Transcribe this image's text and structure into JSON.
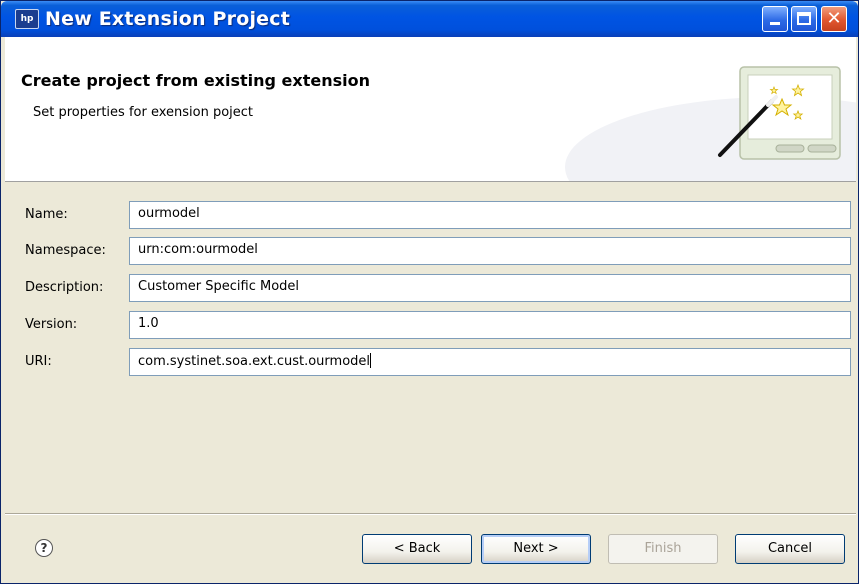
{
  "window": {
    "title": "New Extension Project",
    "app_icon": "hp-logo-icon",
    "controls": [
      "minimize-icon",
      "maximize-icon",
      "close-icon"
    ]
  },
  "header": {
    "title": "Create project from existing extension",
    "subtitle": "Set properties for exension poject",
    "banner_icon": "wizard-wand-icon"
  },
  "form": {
    "name_label": "Name:",
    "name_value": "ourmodel",
    "namespace_label": "Namespace:",
    "namespace_value": "urn:com:ourmodel",
    "description_label": "Description:",
    "description_value": "Customer Specific Model",
    "version_label": "Version:",
    "version_value": "1.0",
    "uri_label": "URI:",
    "uri_value": "com.systinet.soa.ext.cust.ourmodel"
  },
  "buttons": {
    "help_glyph": "?",
    "back_label": "< Back",
    "next_label": "Next >",
    "finish_label": "Finish",
    "cancel_label": "Cancel"
  },
  "colors": {
    "titlebar": "#0054e3",
    "dialog_bg": "#ece9d8",
    "field_border": "#7f9db9"
  }
}
